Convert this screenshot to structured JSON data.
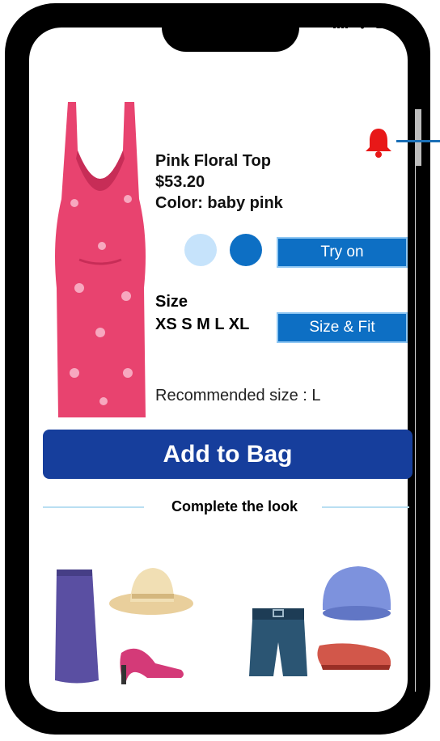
{
  "product": {
    "name": "Pink Floral Top",
    "price": "$53.20",
    "color": "Color: baby pink"
  },
  "colors": {
    "swatch_light": "#c6e3fb",
    "swatch_dark": "#0d6fc4",
    "primary_button": "#0d6fc4",
    "add_to_bag": "#163e9c",
    "alert_bell": "#e81818"
  },
  "actions": {
    "try_on": "Try on",
    "size_fit": "Size & Fit",
    "add_to_bag": "Add to Bag"
  },
  "size": {
    "title": "Size",
    "options": "XS S M L XL",
    "recommended": "Recommended size : L"
  },
  "complete_look": {
    "title": "Complete the look",
    "items": [
      "skirt-icon",
      "sun-hat-icon",
      "high-heel-icon",
      "shorts-icon",
      "cap-icon",
      "flat-shoe-icon"
    ]
  }
}
